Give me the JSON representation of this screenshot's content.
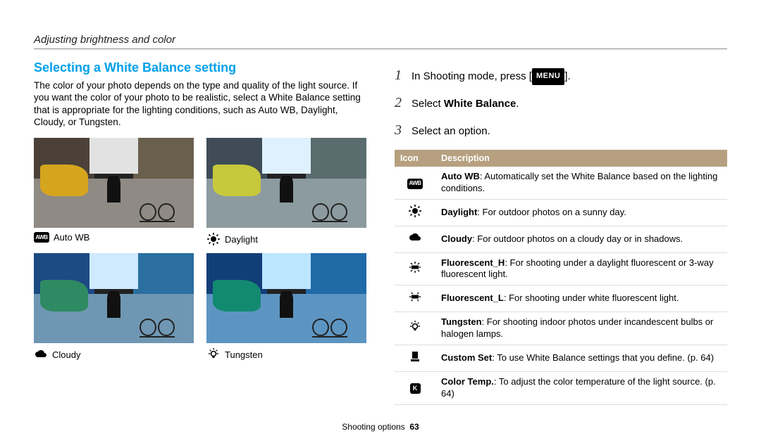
{
  "header": "Adjusting brightness and color",
  "title": "Selecting a White Balance setting",
  "intro": "The color of your photo depends on the type and quality of the light source. If you want the color of your photo to be realistic, select a White Balance setting that is appropriate for the lighting conditions, such as Auto WB, Daylight, Cloudy, or Tungsten.",
  "photos": {
    "a": "Auto WB",
    "b": "Daylight",
    "c": "Cloudy",
    "d": "Tungsten"
  },
  "steps": {
    "s1a": "In Shooting mode, press [",
    "menu": "MENU",
    "s1b": "].",
    "s2a": "Select ",
    "s2b": "White Balance",
    "s2c": ".",
    "s3": "Select an option."
  },
  "table": {
    "h1": "Icon",
    "h2": "Description",
    "rows": {
      "auto": {
        "b": "Auto WB",
        "t": ": Automatically set the White Balance based on the lighting conditions."
      },
      "day": {
        "b": "Daylight",
        "t": ": For outdoor photos on a sunny day."
      },
      "cloud": {
        "b": "Cloudy",
        "t": ": For outdoor photos on a cloudy day or in shadows."
      },
      "fh": {
        "b": "Fluorescent_H",
        "t": ": For shooting under a daylight fluorescent or 3-way fluorescent light."
      },
      "fl": {
        "b": "Fluorescent_L",
        "t": ": For shooting under white fluorescent light."
      },
      "tung": {
        "b": "Tungsten",
        "t": ": For shooting indoor photos under incandescent bulbs or halogen lamps."
      },
      "cust": {
        "b": "Custom Set",
        "t": ": To use White Balance settings that you define. (p. 64)"
      },
      "k": {
        "b": "Color Temp.",
        "t": ": To adjust the color temperature of the light source. (p. 64)"
      }
    }
  },
  "footer": {
    "section": "Shooting options",
    "page": "63"
  },
  "icons": {
    "awb": "AWB",
    "k": "K"
  }
}
